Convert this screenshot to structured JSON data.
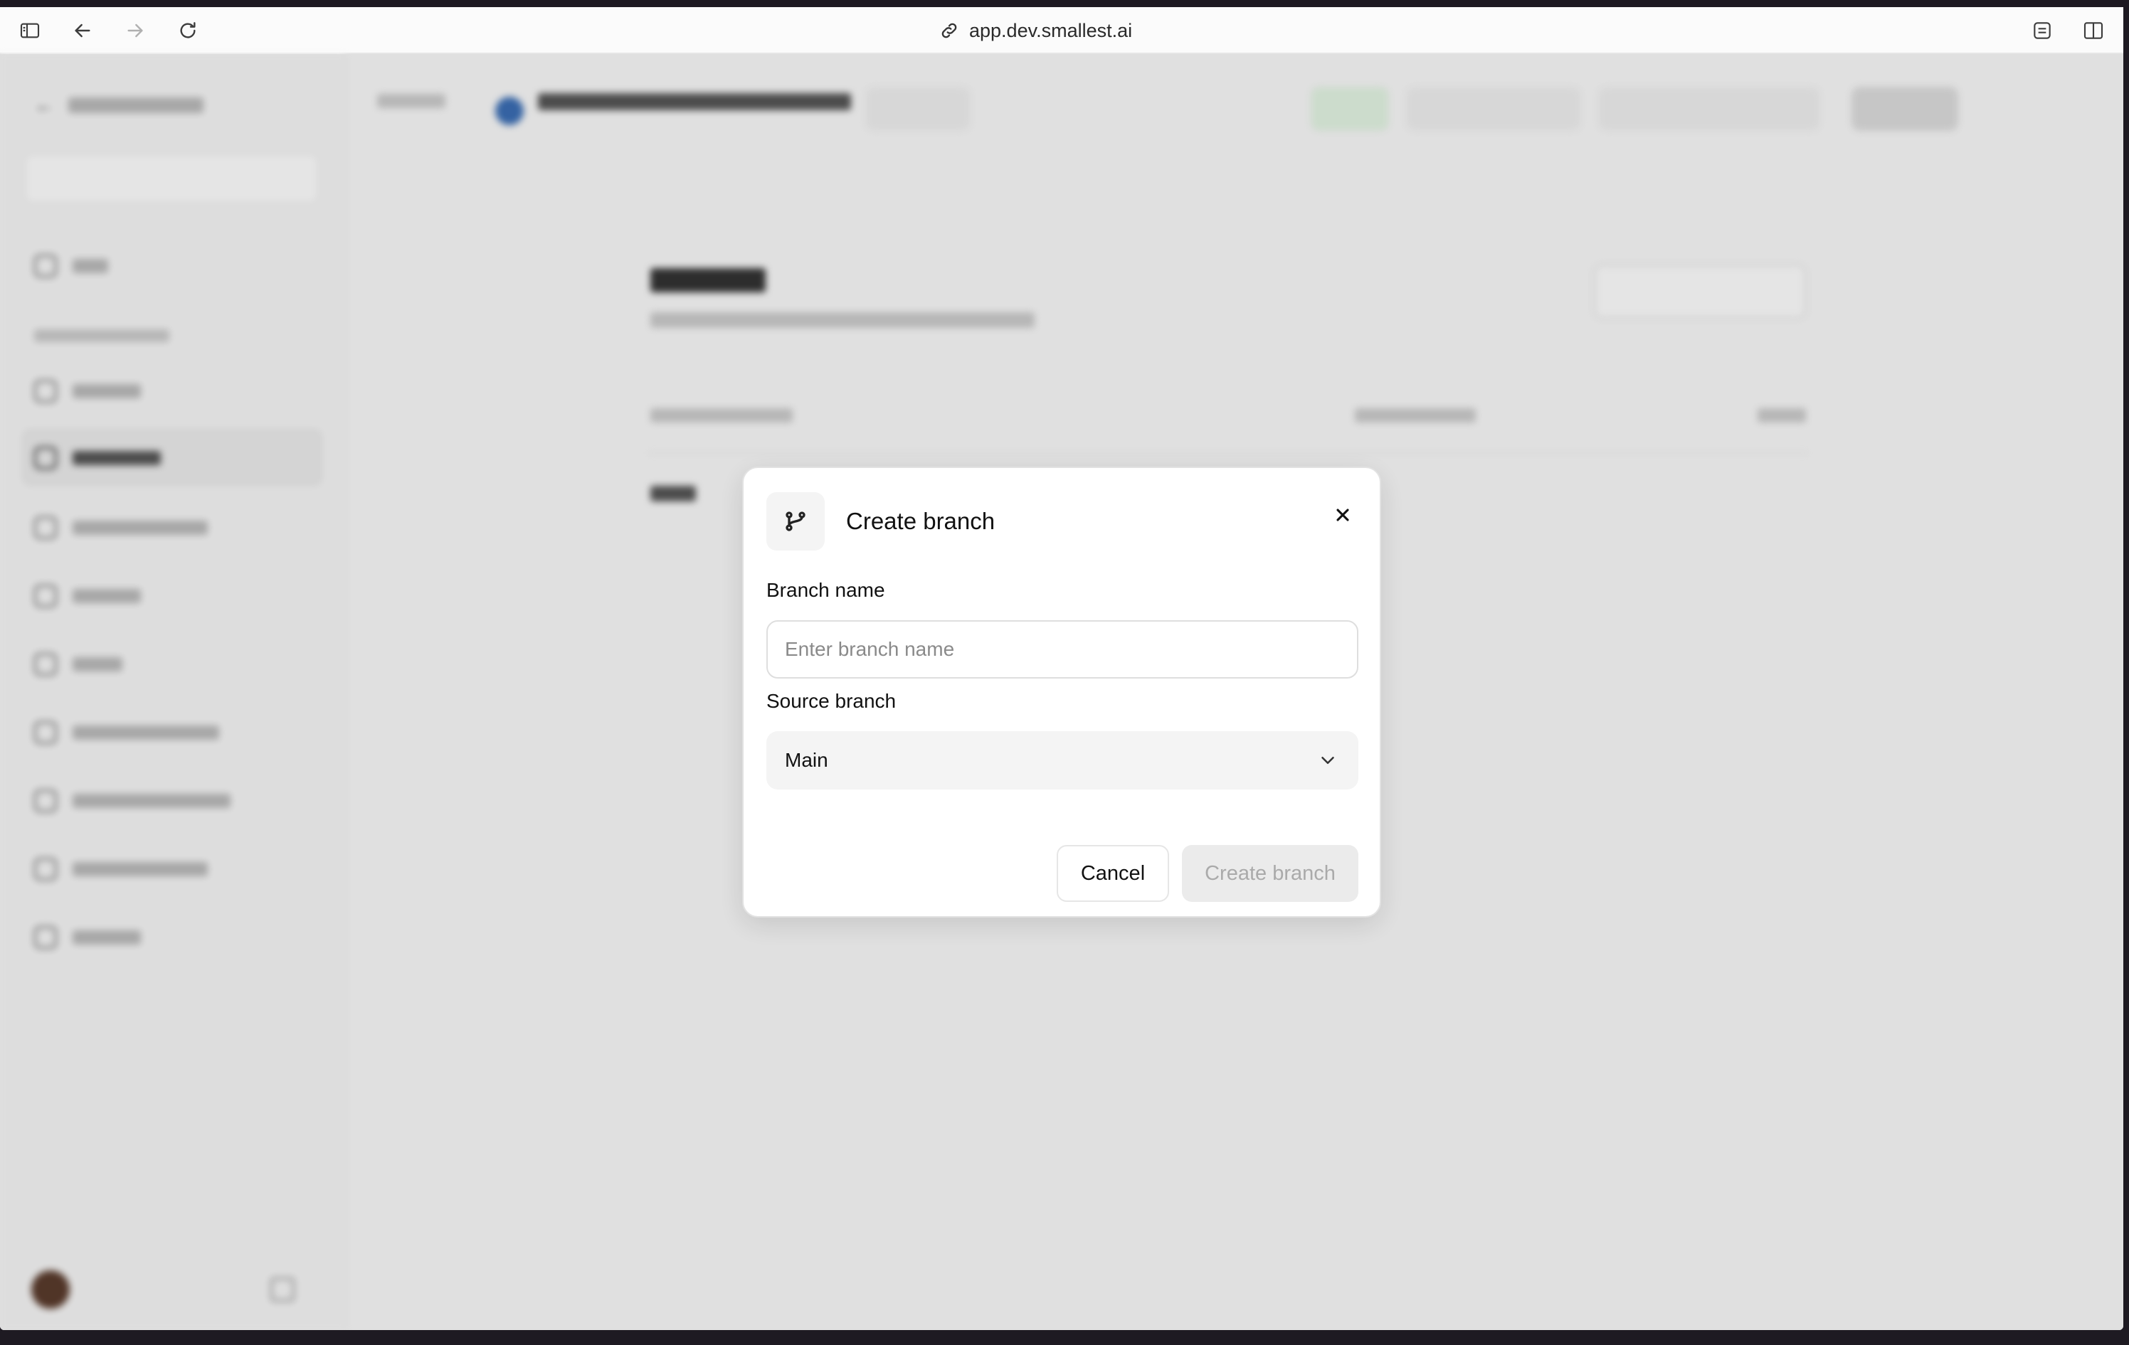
{
  "browser": {
    "url": "app.dev.smallest.ai",
    "icons": [
      "sidebar-toggle-icon",
      "back-arrow-icon",
      "forward-arrow-icon",
      "reload-icon",
      "link-icon",
      "extension-icon",
      "split-view-icon"
    ]
  },
  "dialog": {
    "title": "Create branch",
    "icon": "git-branch-icon",
    "branch_name_label": "Branch name",
    "branch_name_placeholder": "Enter branch name",
    "branch_name_value": "",
    "source_branch_label": "Source branch",
    "source_branch_value": "Main",
    "cancel_label": "Cancel",
    "create_label": "Create branch"
  }
}
